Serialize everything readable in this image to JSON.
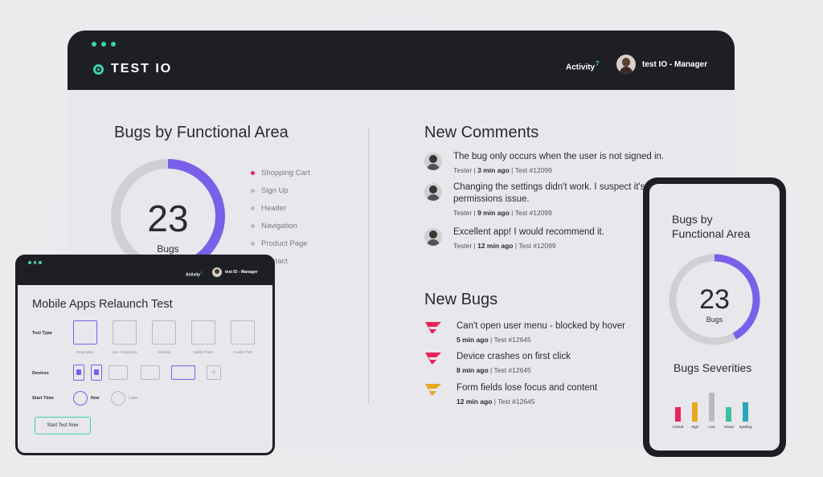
{
  "brand": {
    "name": "TEST IO"
  },
  "header": {
    "activity_label": "Activity",
    "activity_count": "7",
    "user_label": "test IO - Manager"
  },
  "bugs_by_area": {
    "title": "Bugs by Functional Area",
    "count": "23",
    "count_label": "Bugs",
    "progress": 0.42,
    "legend": [
      "Shopping Cart",
      "Sign Up",
      "Header",
      "Navigation",
      "Product Page",
      "Contact"
    ]
  },
  "comments": {
    "title": "New Comments",
    "items": [
      {
        "text": "The bug only occurs when the user is not signed in.",
        "role": "Tester",
        "time": "3 min ago",
        "test": "Test #12099"
      },
      {
        "text": "Changing the settings didn't work. I suspect it's a permissions issue.",
        "role": "Tester",
        "time": "9 min ago",
        "test": "Test #12099"
      },
      {
        "text": "Excellent app! I would recommend it.",
        "role": "Tester",
        "time": "12 min ago",
        "test": "Test #12099"
      }
    ]
  },
  "bugs": {
    "title": "New Bugs",
    "items": [
      {
        "text": "Can't open user menu - blocked by hover",
        "time": "5 min ago",
        "test": "Test #12645",
        "color": "#e8245a"
      },
      {
        "text": "Device crashes on first click",
        "time": "8 min ago",
        "test": "Test #12645",
        "color": "#e8245a"
      },
      {
        "text": "Form fields lose focus and content",
        "time": "12 min ago",
        "test": "Test #12645",
        "color": "#e6a722"
      }
    ]
  },
  "tablet": {
    "title": "Mobile Apps Relaunch Test",
    "activity_label": "Activity",
    "activity_count": "7",
    "user_label": "test IO - Manager",
    "test_type_label": "Test Type",
    "test_types": [
      "Regression",
      "User Acceptance",
      "Usability",
      "Sanity Check",
      "Custom Test"
    ],
    "devices_label": "Devices",
    "start_time_label": "Start Time",
    "start_now": "Now",
    "start_later": "Later",
    "start_button": "Start Test Now"
  },
  "phone": {
    "title_line1": "Bugs by",
    "title_line2": "Functional Area",
    "count": "23",
    "count_label": "Bugs",
    "severities_title": "Bugs Severities",
    "chart_data": {
      "type": "bar",
      "categories": [
        "Critical",
        "High",
        "Low",
        "Visual",
        "Spelling"
      ],
      "values": [
        3,
        4,
        6,
        3,
        4
      ],
      "colors": [
        "#e8245a",
        "#e6a722",
        "#b9b9c0",
        "#3dbfa0",
        "#2aa7b8"
      ]
    }
  },
  "colors": {
    "accent": "#7a60e8",
    "teal": "#3dd1b0",
    "dark": "#1e1f24"
  }
}
